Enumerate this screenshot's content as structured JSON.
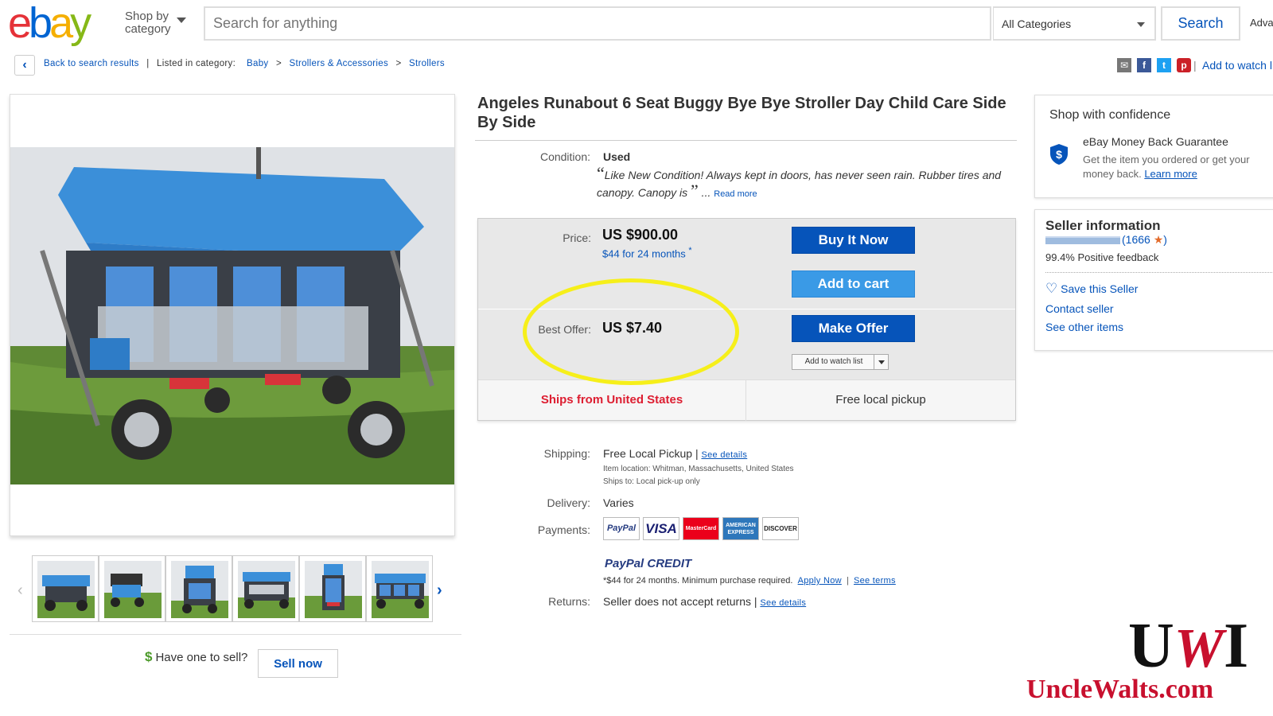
{
  "header": {
    "shop_by_line1": "Shop by",
    "shop_by_line2": "category",
    "search_placeholder": "Search for anything",
    "category_selected": "All Categories",
    "search_button": "Search",
    "advanced": "Advanced"
  },
  "breadcrumb": {
    "back": "Back to search results",
    "listed_in": "Listed in category:",
    "items": [
      "Baby",
      "Strollers & Accessories",
      "Strollers"
    ],
    "add_to_watch": "Add to watch list"
  },
  "listing": {
    "title": "Angeles Runabout 6 Seat Buggy Bye Bye Stroller Day Child Care Side By Side",
    "condition_label": "Condition:",
    "condition_value": "Used",
    "condition_desc": "Like New Condition! Always kept in doors, has never seen rain. Rubber tires and canopy. Canopy is",
    "read_more": "Read more"
  },
  "purchase": {
    "price_label": "Price:",
    "price": "US $900.00",
    "financing": "$44 for 24 months",
    "buy_now": "Buy It Now",
    "add_to_cart": "Add to cart",
    "best_offer_label": "Best Offer:",
    "best_offer": "US $7.40",
    "make_offer": "Make Offer",
    "add_to_watch_list": "Add to watch list",
    "ships_from": "Ships from United States",
    "pickup": "Free local pickup"
  },
  "details": {
    "shipping_label": "Shipping:",
    "shipping_value": "Free Local Pickup |",
    "see_details": "See details",
    "item_location": "Item location:  Whitman, Massachusetts, United States",
    "ships_to": "Ships to:  Local pick-up only",
    "delivery_label": "Delivery:",
    "delivery_value": "Varies",
    "payments_label": "Payments:",
    "cards": [
      "PayPal",
      "VISA",
      "MasterCard",
      "AMERICAN EXPRESS",
      "DISCOVER"
    ],
    "paypal": "PayPal",
    "credit": "CREDIT",
    "credit_terms": "*$44 for 24 months. Minimum purchase required.",
    "apply_now": "Apply Now",
    "see_terms": "See terms",
    "returns_label": "Returns:",
    "returns_value": "Seller does not accept returns |",
    "returns_details": "See details"
  },
  "confidence": {
    "title": "Shop with confidence",
    "heading": "eBay Money Back Guarantee",
    "text": "Get the item you ordered or get your money back.",
    "learn_more": "Learn more"
  },
  "seller": {
    "title": "Seller information",
    "score": "(1666",
    "score_close": ")",
    "feedback": "99.4% Positive feedback",
    "save": "Save this Seller",
    "contact": "Contact seller",
    "other": "See other items"
  },
  "sell": {
    "question": "Have one to sell?",
    "button": "Sell now"
  },
  "watermark": {
    "logo_u": "U",
    "logo_w": "W",
    "logo_i": "I",
    "url": "UncleWalts.com"
  },
  "colors": {
    "ebay_blue": "#0654ba",
    "button_blue": "#0654ba",
    "highlight_circle": "#f6ef1a",
    "watermark_red": "#c8102e"
  },
  "icons": [
    "chevron-left-icon",
    "email-icon",
    "facebook-icon",
    "twitter-icon",
    "pinterest-icon",
    "shield-icon",
    "heart-icon",
    "star-icon",
    "chevron-right-icon"
  ]
}
